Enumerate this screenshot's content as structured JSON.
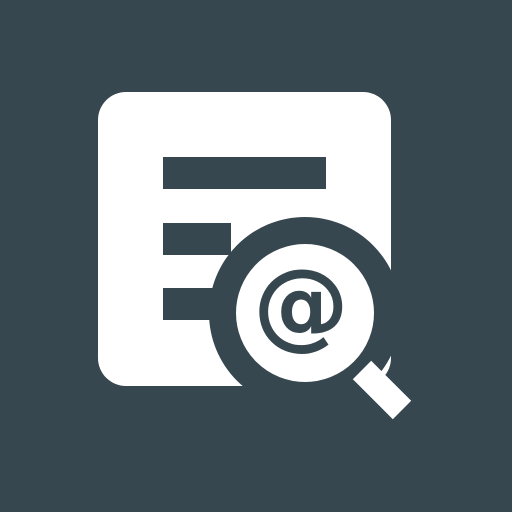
{
  "icon": {
    "name": "email-search-icon",
    "background_color": "#37474f",
    "foreground_color": "#ffffff",
    "glyph": "@"
  }
}
